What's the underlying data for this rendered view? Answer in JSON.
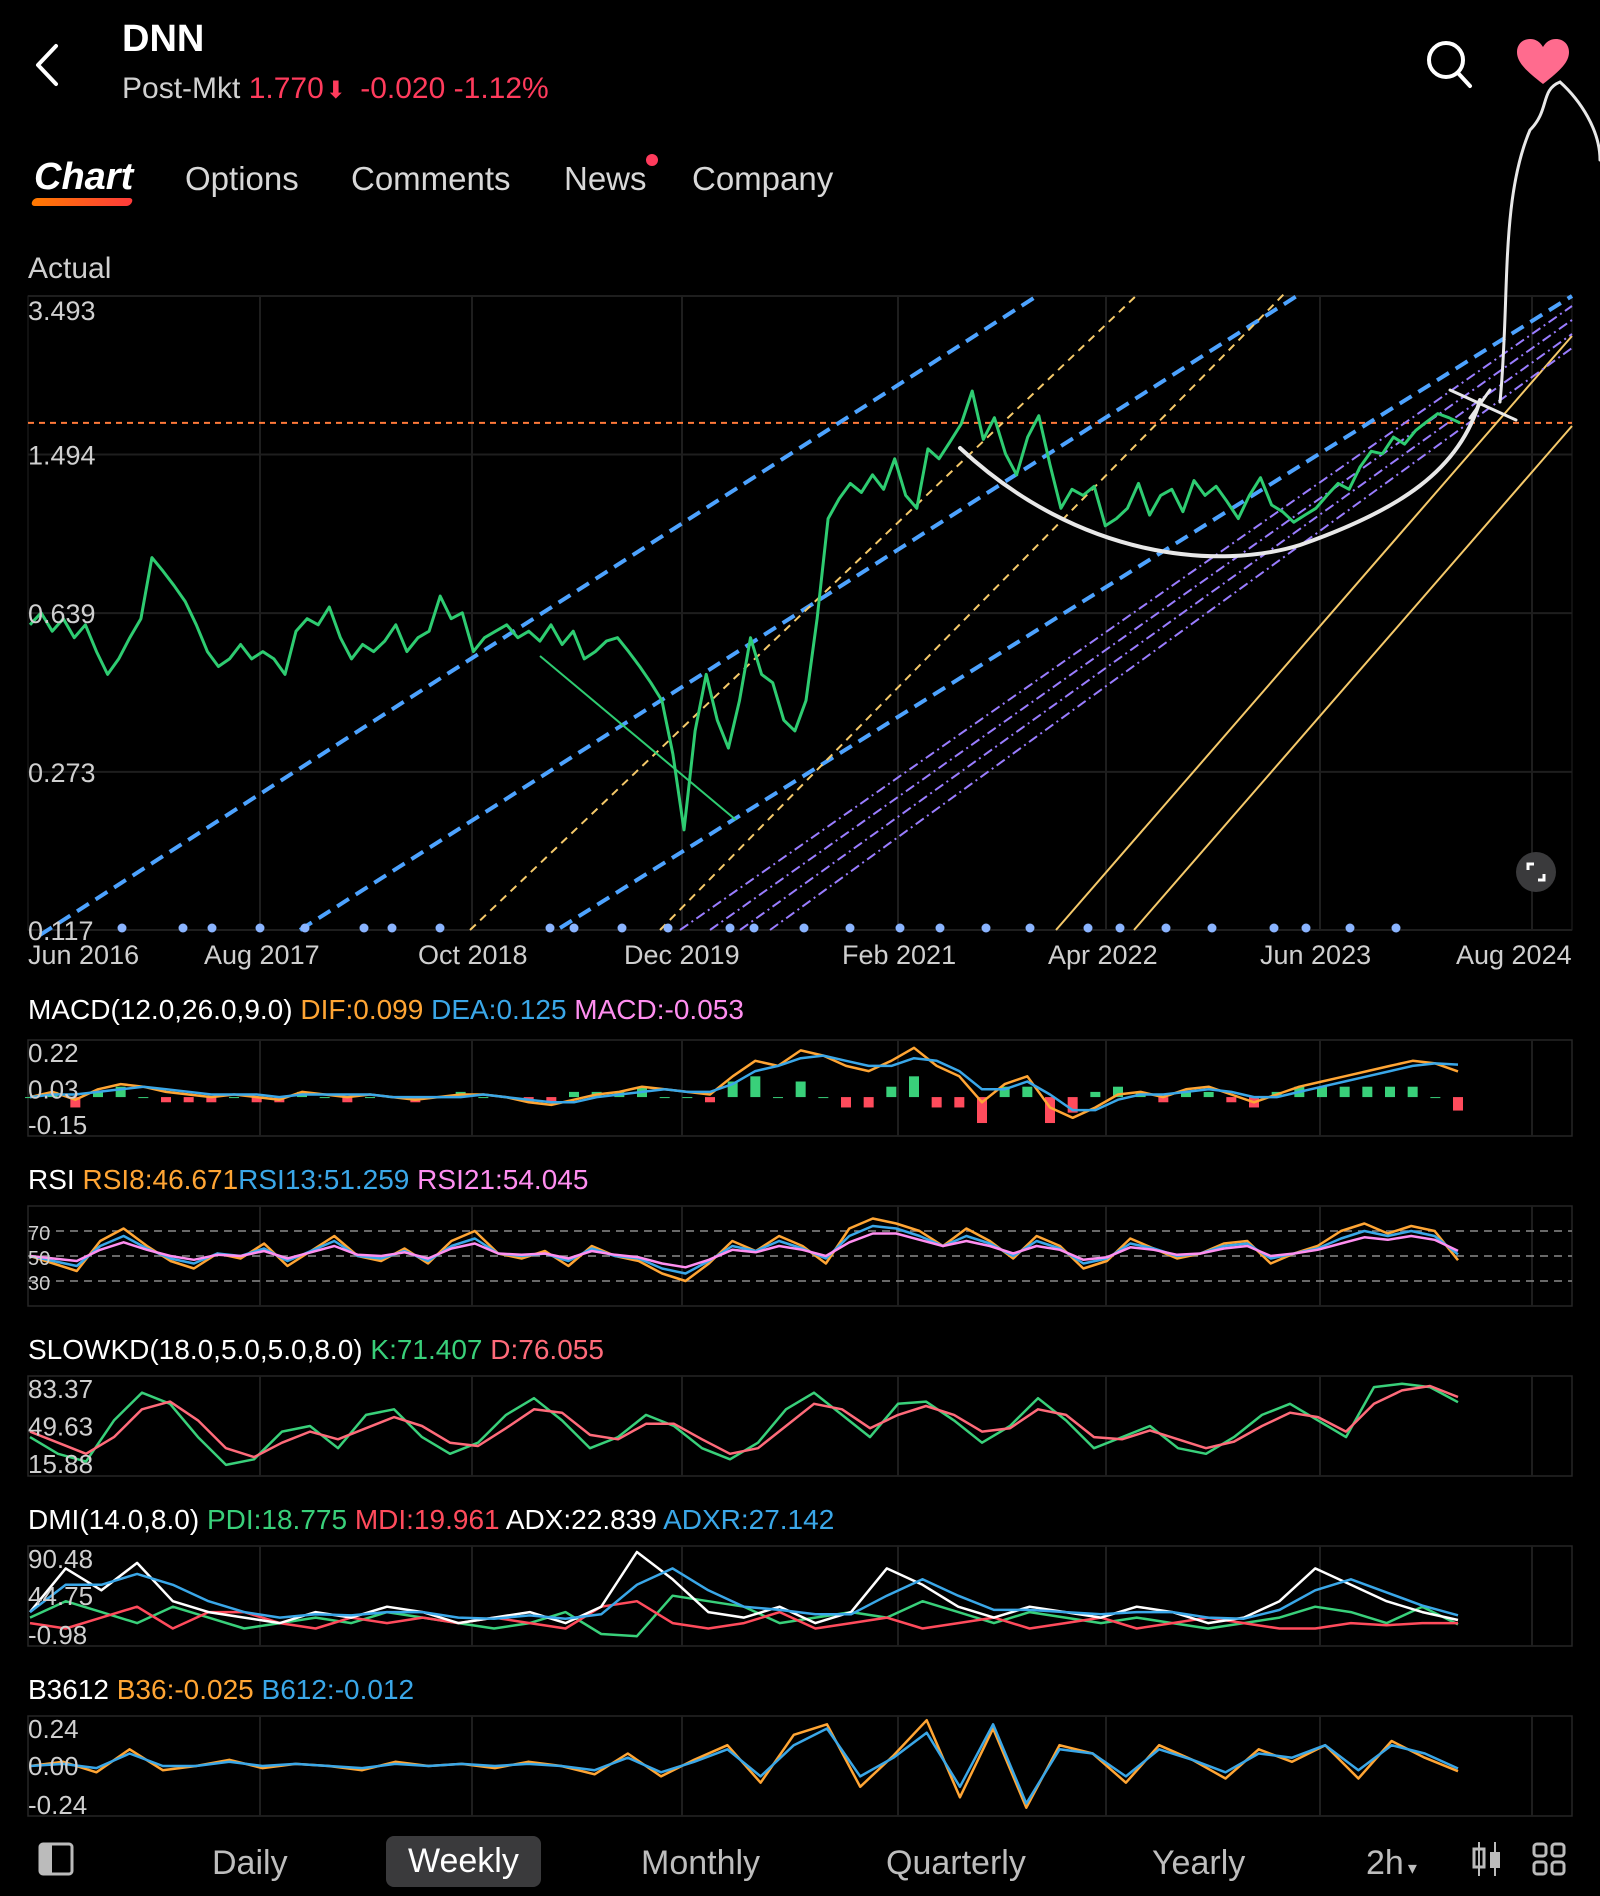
{
  "header": {
    "ticker": "DNN",
    "session_label": "Post-Mkt",
    "price": "1.770",
    "change": "-0.020",
    "change_pct": "-1.12%",
    "price_color": "#ff3b5c",
    "icons": [
      "back-arrow-icon",
      "search-icon",
      "heart-icon"
    ]
  },
  "tabs": [
    {
      "label": "Chart",
      "active": true
    },
    {
      "label": "Options"
    },
    {
      "label": "Comments"
    },
    {
      "label": "News",
      "badge": true
    },
    {
      "label": "Company"
    }
  ],
  "price_mode_label": "Actual",
  "colors": {
    "price_line": "#2ecc71",
    "trend_blue": "#4da3ff",
    "trend_yellow": "#f5c96a",
    "trend_purple": "#9a7dff",
    "ref_line": "#ff7a3a",
    "orange": "#ffa534",
    "blue": "#3aa7e8",
    "pink": "#ff8ef0",
    "green": "#39d07a",
    "red": "#ff4b5c",
    "white": "#ffffff"
  },
  "chart_data": [
    {
      "type": "line",
      "name": "price",
      "x_ticks": [
        "Jun 2016",
        "Aug 2017",
        "Oct 2018",
        "Dec 2019",
        "Feb 2021",
        "Apr 2022",
        "Jun 2023",
        "Aug 2024"
      ],
      "y_ticks": [
        "3.493",
        "1.494",
        "0.639",
        "0.273",
        "0.117"
      ],
      "scale": "log",
      "ylim": [
        0.117,
        3.493
      ],
      "reference_line": 1.77,
      "series": [
        {
          "values": [
            0.6,
            0.64,
            0.58,
            0.62,
            0.56,
            0.6,
            0.52,
            0.46,
            0.5,
            0.56,
            0.62,
            0.86,
            0.8,
            0.74,
            0.68,
            0.6,
            0.52,
            0.48,
            0.5,
            0.54,
            0.5,
            0.52,
            0.5,
            0.46,
            0.58,
            0.62,
            0.6,
            0.66,
            0.56,
            0.5,
            0.54,
            0.52,
            0.55,
            0.6,
            0.52,
            0.56,
            0.58,
            0.7,
            0.62,
            0.64,
            0.52,
            0.56,
            0.58,
            0.6,
            0.56,
            0.58,
            0.55,
            0.6,
            0.54,
            0.58,
            0.5,
            0.52,
            0.55,
            0.56,
            0.52,
            0.48,
            0.44,
            0.4,
            0.3,
            0.2,
            0.34,
            0.46,
            0.36,
            0.31,
            0.4,
            0.56,
            0.46,
            0.44,
            0.36,
            0.34,
            0.4,
            0.62,
            1.06,
            1.18,
            1.28,
            1.22,
            1.34,
            1.24,
            1.46,
            1.2,
            1.12,
            1.54,
            1.46,
            1.6,
            1.76,
            2.1,
            1.62,
            1.82,
            1.5,
            1.34,
            1.64,
            1.84,
            1.42,
            1.12,
            1.24,
            1.2,
            1.26,
            1.02,
            1.06,
            1.12,
            1.28,
            1.08,
            1.2,
            1.24,
            1.1,
            1.3,
            1.2,
            1.26,
            1.16,
            1.06,
            1.2,
            1.32,
            1.14,
            1.1,
            1.04,
            1.08,
            1.12,
            1.2,
            1.28,
            1.24,
            1.4,
            1.52,
            1.5,
            1.64,
            1.58,
            1.7,
            1.78,
            1.86,
            1.82,
            1.77
          ]
        }
      ]
    },
    {
      "type": "bar",
      "name": "MACD",
      "title": "MACD(12.0,26.0,9.0)",
      "legend": [
        {
          "label": "DIF:0.099",
          "color": "#ffa534"
        },
        {
          "label": "DEA:0.125",
          "color": "#3aa7e8"
        },
        {
          "label": "MACD:-0.053",
          "color": "#ff8ef0"
        }
      ],
      "y_ticks": [
        "0.22",
        "0.03",
        "-0.15"
      ],
      "ylim": [
        -0.15,
        0.22
      ],
      "series": [
        {
          "name": "DIF",
          "values": [
            0,
            0.02,
            -0.01,
            0.03,
            0.05,
            0.04,
            0.02,
            0.01,
            0,
            0.01,
            0,
            -0.01,
            0.02,
            0.01,
            0,
            0.01,
            0,
            -0.01,
            0,
            0.01,
            0.01,
            0,
            -0.02,
            -0.03,
            -0.01,
            0.01,
            0.02,
            0.04,
            0.03,
            0.02,
            0.01,
            0.08,
            0.14,
            0.12,
            0.18,
            0.16,
            0.12,
            0.1,
            0.14,
            0.19,
            0.12,
            0.08,
            -0.02,
            0.05,
            0.08,
            -0.04,
            -0.08,
            -0.04,
            0.01,
            0.02,
            0,
            0.03,
            0.04,
            0.01,
            -0.02,
            0.01,
            0.04,
            0.06,
            0.08,
            0.1,
            0.12,
            0.14,
            0.13,
            0.099
          ]
        },
        {
          "name": "DEA",
          "values": [
            0,
            0.01,
            0.01,
            0.02,
            0.03,
            0.04,
            0.03,
            0.02,
            0.01,
            0.01,
            0.01,
            0,
            0.01,
            0.01,
            0.01,
            0.01,
            0,
            0,
            0,
            0,
            0.01,
            0,
            -0.01,
            -0.02,
            -0.02,
            0,
            0.01,
            0.02,
            0.03,
            0.02,
            0.02,
            0.05,
            0.1,
            0.12,
            0.15,
            0.16,
            0.14,
            0.12,
            0.12,
            0.15,
            0.14,
            0.1,
            0.03,
            0.03,
            0.06,
            0.01,
            -0.05,
            -0.05,
            -0.01,
            0.01,
            0.01,
            0.02,
            0.03,
            0.02,
            0,
            0,
            0.02,
            0.04,
            0.06,
            0.08,
            0.1,
            0.12,
            0.13,
            0.125
          ]
        }
      ]
    },
    {
      "type": "line",
      "name": "RSI",
      "title": "RSI",
      "legend": [
        {
          "label": "RSI8:46.671",
          "color": "#ffa534"
        },
        {
          "label": "RSI13:51.259",
          "color": "#3aa7e8"
        },
        {
          "label": "RSI21:54.045",
          "color": "#ff8ef0"
        }
      ],
      "y_ticks": [
        "70",
        "50",
        "30"
      ],
      "ylim": [
        10,
        90
      ],
      "series": [
        {
          "name": "RSI8",
          "values": [
            50,
            44,
            38,
            62,
            72,
            58,
            46,
            40,
            52,
            48,
            60,
            42,
            54,
            66,
            50,
            46,
            56,
            44,
            62,
            70,
            52,
            48,
            54,
            42,
            58,
            50,
            46,
            36,
            30,
            44,
            62,
            54,
            66,
            58,
            44,
            72,
            80,
            76,
            70,
            58,
            72,
            62,
            48,
            66,
            58,
            40,
            46,
            64,
            56,
            48,
            52,
            60,
            62,
            44,
            52,
            58,
            70,
            76,
            68,
            74,
            70,
            46.671
          ]
        },
        {
          "name": "RSI13",
          "values": [
            50,
            46,
            42,
            58,
            66,
            56,
            48,
            44,
            52,
            50,
            56,
            46,
            54,
            62,
            50,
            48,
            54,
            46,
            58,
            64,
            52,
            50,
            52,
            46,
            56,
            50,
            48,
            40,
            36,
            46,
            58,
            54,
            62,
            56,
            48,
            66,
            74,
            72,
            66,
            58,
            66,
            60,
            50,
            62,
            56,
            44,
            48,
            60,
            56,
            50,
            52,
            58,
            60,
            48,
            52,
            56,
            64,
            70,
            66,
            70,
            66,
            51.259
          ]
        },
        {
          "name": "RSI21",
          "values": [
            50,
            48,
            46,
            55,
            61,
            55,
            50,
            47,
            51,
            50,
            54,
            48,
            53,
            58,
            51,
            50,
            53,
            48,
            56,
            60,
            52,
            51,
            52,
            48,
            54,
            51,
            49,
            44,
            41,
            47,
            55,
            53,
            58,
            55,
            50,
            61,
            68,
            68,
            63,
            58,
            62,
            58,
            52,
            58,
            55,
            47,
            49,
            57,
            55,
            51,
            52,
            56,
            58,
            50,
            52,
            55,
            60,
            65,
            63,
            66,
            63,
            54.045
          ]
        }
      ]
    },
    {
      "type": "line",
      "name": "SLOWKD",
      "title": "SLOWKD(18.0,5.0,5.0,8.0)",
      "legend": [
        {
          "label": "K:71.407",
          "color": "#39d07a"
        },
        {
          "label": "D:76.055",
          "color": "#ff6b7a"
        }
      ],
      "y_ticks": [
        "83.37",
        "49.63",
        "15.88"
      ],
      "ylim": [
        5,
        95
      ],
      "series": [
        {
          "name": "K",
          "values": [
            40,
            25,
            18,
            55,
            80,
            70,
            40,
            15,
            20,
            45,
            50,
            30,
            60,
            65,
            40,
            25,
            35,
            60,
            75,
            55,
            30,
            40,
            60,
            50,
            30,
            20,
            35,
            65,
            80,
            60,
            40,
            70,
            72,
            55,
            35,
            50,
            75,
            55,
            30,
            40,
            50,
            30,
            25,
            40,
            60,
            70,
            55,
            40,
            85,
            88,
            85,
            71.407
          ]
        },
        {
          "name": "D",
          "values": [
            45,
            35,
            25,
            40,
            65,
            72,
            55,
            30,
            22,
            35,
            45,
            38,
            48,
            58,
            50,
            35,
            32,
            48,
            65,
            62,
            42,
            38,
            52,
            52,
            38,
            25,
            30,
            50,
            70,
            65,
            48,
            60,
            68,
            60,
            45,
            48,
            65,
            60,
            40,
            38,
            46,
            38,
            30,
            36,
            50,
            62,
            58,
            45,
            70,
            82,
            86,
            76.055
          ]
        }
      ]
    },
    {
      "type": "line",
      "name": "DMI",
      "title": "DMI(14.0,8.0)",
      "legend": [
        {
          "label": "PDI:18.775",
          "color": "#39d07a"
        },
        {
          "label": "MDI:19.961",
          "color": "#ff4b5c"
        },
        {
          "label": "ADX:22.839",
          "color": "#ffffff"
        },
        {
          "label": "ADXR:27.142",
          "color": "#3aa7e8"
        }
      ],
      "y_ticks": [
        "90.48",
        "44.75",
        "-0.98"
      ],
      "ylim": [
        -0.98,
        90.48
      ],
      "series": [
        {
          "name": "PDI",
          "values": [
            25,
            40,
            30,
            20,
            35,
            25,
            15,
            20,
            25,
            20,
            30,
            25,
            20,
            15,
            20,
            30,
            10,
            8,
            45,
            40,
            35,
            20,
            25,
            30,
            25,
            40,
            30,
            20,
            30,
            25,
            20,
            25,
            20,
            15,
            20,
            25,
            35,
            30,
            20,
            35,
            18.775
          ]
        },
        {
          "name": "MDI",
          "values": [
            20,
            15,
            25,
            35,
            15,
            30,
            30,
            20,
            15,
            25,
            20,
            25,
            20,
            25,
            20,
            15,
            35,
            40,
            20,
            15,
            20,
            30,
            15,
            20,
            25,
            15,
            20,
            25,
            15,
            20,
            25,
            15,
            20,
            25,
            20,
            15,
            15,
            20,
            18,
            20,
            19.961
          ]
        },
        {
          "name": "ADX",
          "values": [
            30,
            70,
            50,
            75,
            40,
            30,
            25,
            20,
            30,
            25,
            35,
            30,
            20,
            25,
            30,
            20,
            35,
            85,
            60,
            30,
            25,
            35,
            20,
            30,
            70,
            55,
            35,
            25,
            35,
            30,
            25,
            35,
            30,
            20,
            25,
            40,
            70,
            55,
            40,
            30,
            22.839
          ]
        },
        {
          "name": "ADXR",
          "values": [
            30,
            55,
            55,
            65,
            55,
            40,
            30,
            25,
            28,
            27,
            30,
            30,
            25,
            24,
            27,
            24,
            28,
            55,
            70,
            50,
            35,
            32,
            28,
            28,
            45,
            60,
            45,
            32,
            32,
            30,
            28,
            30,
            30,
            25,
            24,
            32,
            50,
            60,
            48,
            36,
            27.142
          ]
        }
      ]
    },
    {
      "type": "line",
      "name": "B3612",
      "title": "B3612",
      "legend": [
        {
          "label": "B36:-0.025",
          "color": "#ffa534"
        },
        {
          "label": "B612:-0.012",
          "color": "#3aa7e8"
        }
      ],
      "y_ticks": [
        "0.24",
        "0.00",
        "-0.24"
      ],
      "ylim": [
        -0.24,
        0.24
      ],
      "series": [
        {
          "name": "B36",
          "values": [
            0,
            0.02,
            -0.03,
            0.08,
            -0.02,
            0,
            0.03,
            -0.01,
            0.01,
            0,
            -0.02,
            0.02,
            0,
            0.01,
            -0.01,
            0.02,
            0,
            -0.04,
            0.06,
            -0.05,
            0.03,
            0.1,
            -0.08,
            0.15,
            0.2,
            -0.1,
            0.05,
            0.22,
            -0.15,
            0.18,
            -0.2,
            0.1,
            0.06,
            -0.08,
            0.1,
            0.03,
            -0.06,
            0.08,
            0.02,
            0.1,
            -0.06,
            0.12,
            0.04,
            -0.025
          ]
        },
        {
          "name": "B612",
          "values": [
            0,
            0.01,
            -0.01,
            0.06,
            0,
            0,
            0.02,
            0,
            0.01,
            0,
            -0.01,
            0.01,
            0,
            0.01,
            0,
            0.01,
            0,
            -0.02,
            0.04,
            -0.03,
            0.02,
            0.08,
            -0.05,
            0.1,
            0.18,
            -0.05,
            0.04,
            0.16,
            -0.1,
            0.2,
            -0.18,
            0.08,
            0.06,
            -0.05,
            0.08,
            0.03,
            -0.03,
            0.06,
            0.04,
            0.1,
            -0.02,
            0.1,
            0.06,
            -0.012
          ]
        }
      ]
    }
  ],
  "expand_icon": "expand-icon",
  "bottom_bar": {
    "layout_icon": "sidebar-toggle-icon",
    "periods": [
      {
        "label": "Daily"
      },
      {
        "label": "Weekly",
        "active": true
      },
      {
        "label": "Monthly"
      },
      {
        "label": "Quarterly"
      },
      {
        "label": "Yearly"
      }
    ],
    "interval": "2h",
    "candle_icon": "candlestick-icon",
    "grid_icon": "grid-icon"
  }
}
